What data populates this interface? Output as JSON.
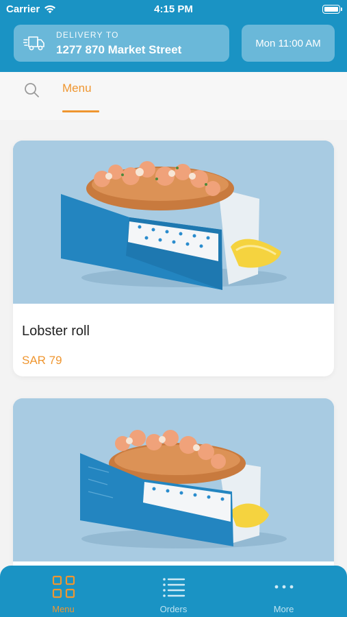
{
  "status_bar": {
    "carrier": "Carrier",
    "time": "4:15 PM"
  },
  "header": {
    "delivery_label": "DELIVERY TO",
    "delivery_address": "1277 870 Market Street",
    "schedule": "Mon 11:00 AM"
  },
  "tabs": {
    "menu_label": "Menu"
  },
  "menu_items": [
    {
      "name": "Lobster roll",
      "price": "SAR 79"
    },
    {
      "name": "",
      "price": ""
    }
  ],
  "bottom_nav": [
    {
      "label": "Menu",
      "icon": "grid-icon",
      "active": true
    },
    {
      "label": "Orders",
      "icon": "list-icon",
      "active": false
    },
    {
      "label": "More",
      "icon": "more-dots-icon",
      "active": false
    }
  ],
  "colors": {
    "primary": "#1a93c4",
    "accent": "#ef9630",
    "header_button": "#6ab8d9"
  }
}
